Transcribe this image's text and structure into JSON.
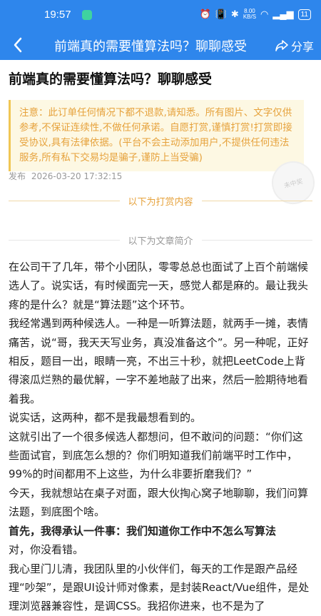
{
  "status": {
    "time": "19:57",
    "netspeed": "8.00\nKB/S",
    "battery": "11"
  },
  "nav": {
    "back": "‹",
    "title": "前端真的需要懂算法吗？聊聊感受",
    "share_label": "分享"
  },
  "article": {
    "title": "前端真的需要懂算法吗？聊聊感受",
    "notice": "注意：此订单任何情况下都不退款,请知悉。所有图片、文字仅供参考,不保证连续性,不做任何承诺。自愿打赏,谨慎打赏!打赏即接受协议,具有法律依据。(平台不会主动添加用户,不提供任何违法服务,所有私下交易均是骗子,谨防上当受骗)",
    "publish_label": "发布",
    "publish_time": "2026-03-20 17:32:15",
    "stamp_text": "未中奖",
    "reward_divider": "以下为打赏内容",
    "intro_divider": "以下为文章简介",
    "paragraphs": [
      {
        "text": "在公司干了几年，带个小团队，零零总总也面试了上百个前端候选人了。说实话，有时候面完一天，感觉人都是麻的。最让我头疼的是什么？就是“算法题”这个环节。",
        "bold": false
      },
      {
        "text": "我经常遇到两种候选人。一种是一听算法题，就两手一摊，表情痛苦，说“哥，我天天写业务，真没准备这个”。另一种呢，正好相反，题目一出，眼睛一亮，不出三十秒，就把LeetCode上背得滚瓜烂熟的最优解，一字不差地敲了出来，然后一脸期待地看着我。",
        "bold": false
      },
      {
        "text": "说实话，这两种，都不是我最想看到的。",
        "bold": false
      },
      {
        "text": "这就引出了一个很多候选人都想问，但不敢问的问题：“你们这些面试官，到底怎么想的？你们明知道我们前端平时工作中，99%的时间都用不上这些，为什么非要折磨我们？”",
        "bold": false
      },
      {
        "text": "今天，我就想站在桌子对面，跟大伙掏心窝子地聊聊，我们问算法题，到底图个啥。",
        "bold": false
      },
      {
        "text": "首先，我得承认一件事：我们知道你工作中不怎么写算法",
        "bold": true
      },
      {
        "text": "对，你没看错。",
        "bold": false
      },
      {
        "text": "我心里门儿清，我团队里的小伙伴们，每天的工作是跟产品经理“吵架”，是跟UI设计师对像素，是封装React/Vue组件，是处理浏览器兼容性，是调CSS。我招你进来，也不是为了",
        "bold": false
      }
    ]
  }
}
